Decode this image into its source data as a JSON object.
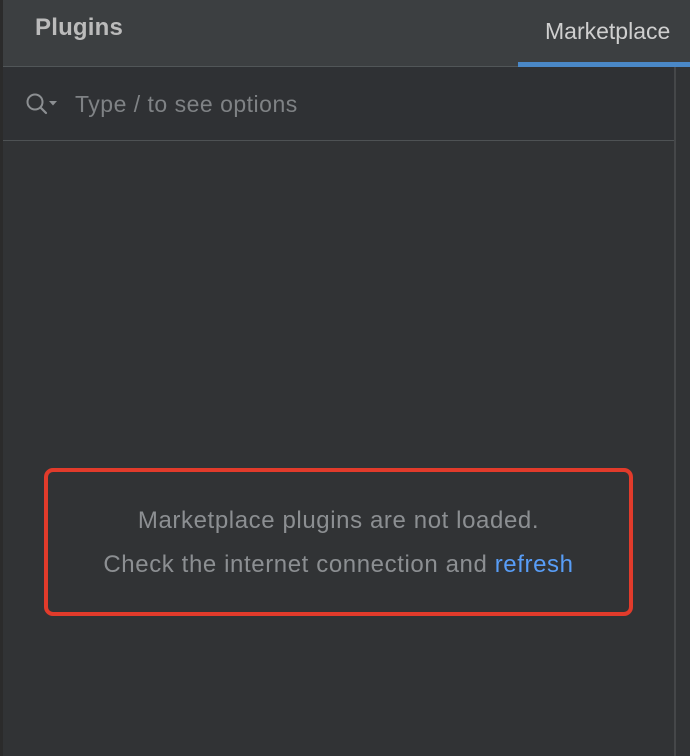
{
  "header": {
    "title": "Plugins",
    "tabs": [
      {
        "label": "Marketplace",
        "active": true
      }
    ]
  },
  "search": {
    "placeholder": "Type / to see options",
    "value": "",
    "icon": "search-icon"
  },
  "empty_state": {
    "line1": "Marketplace plugins are not loaded.",
    "line2_prefix": "Check the internet connection and",
    "refresh_label": "refresh"
  },
  "colors": {
    "accent": "#4a88c7",
    "link": "#589df6",
    "highlight_border": "#e13b2b"
  }
}
